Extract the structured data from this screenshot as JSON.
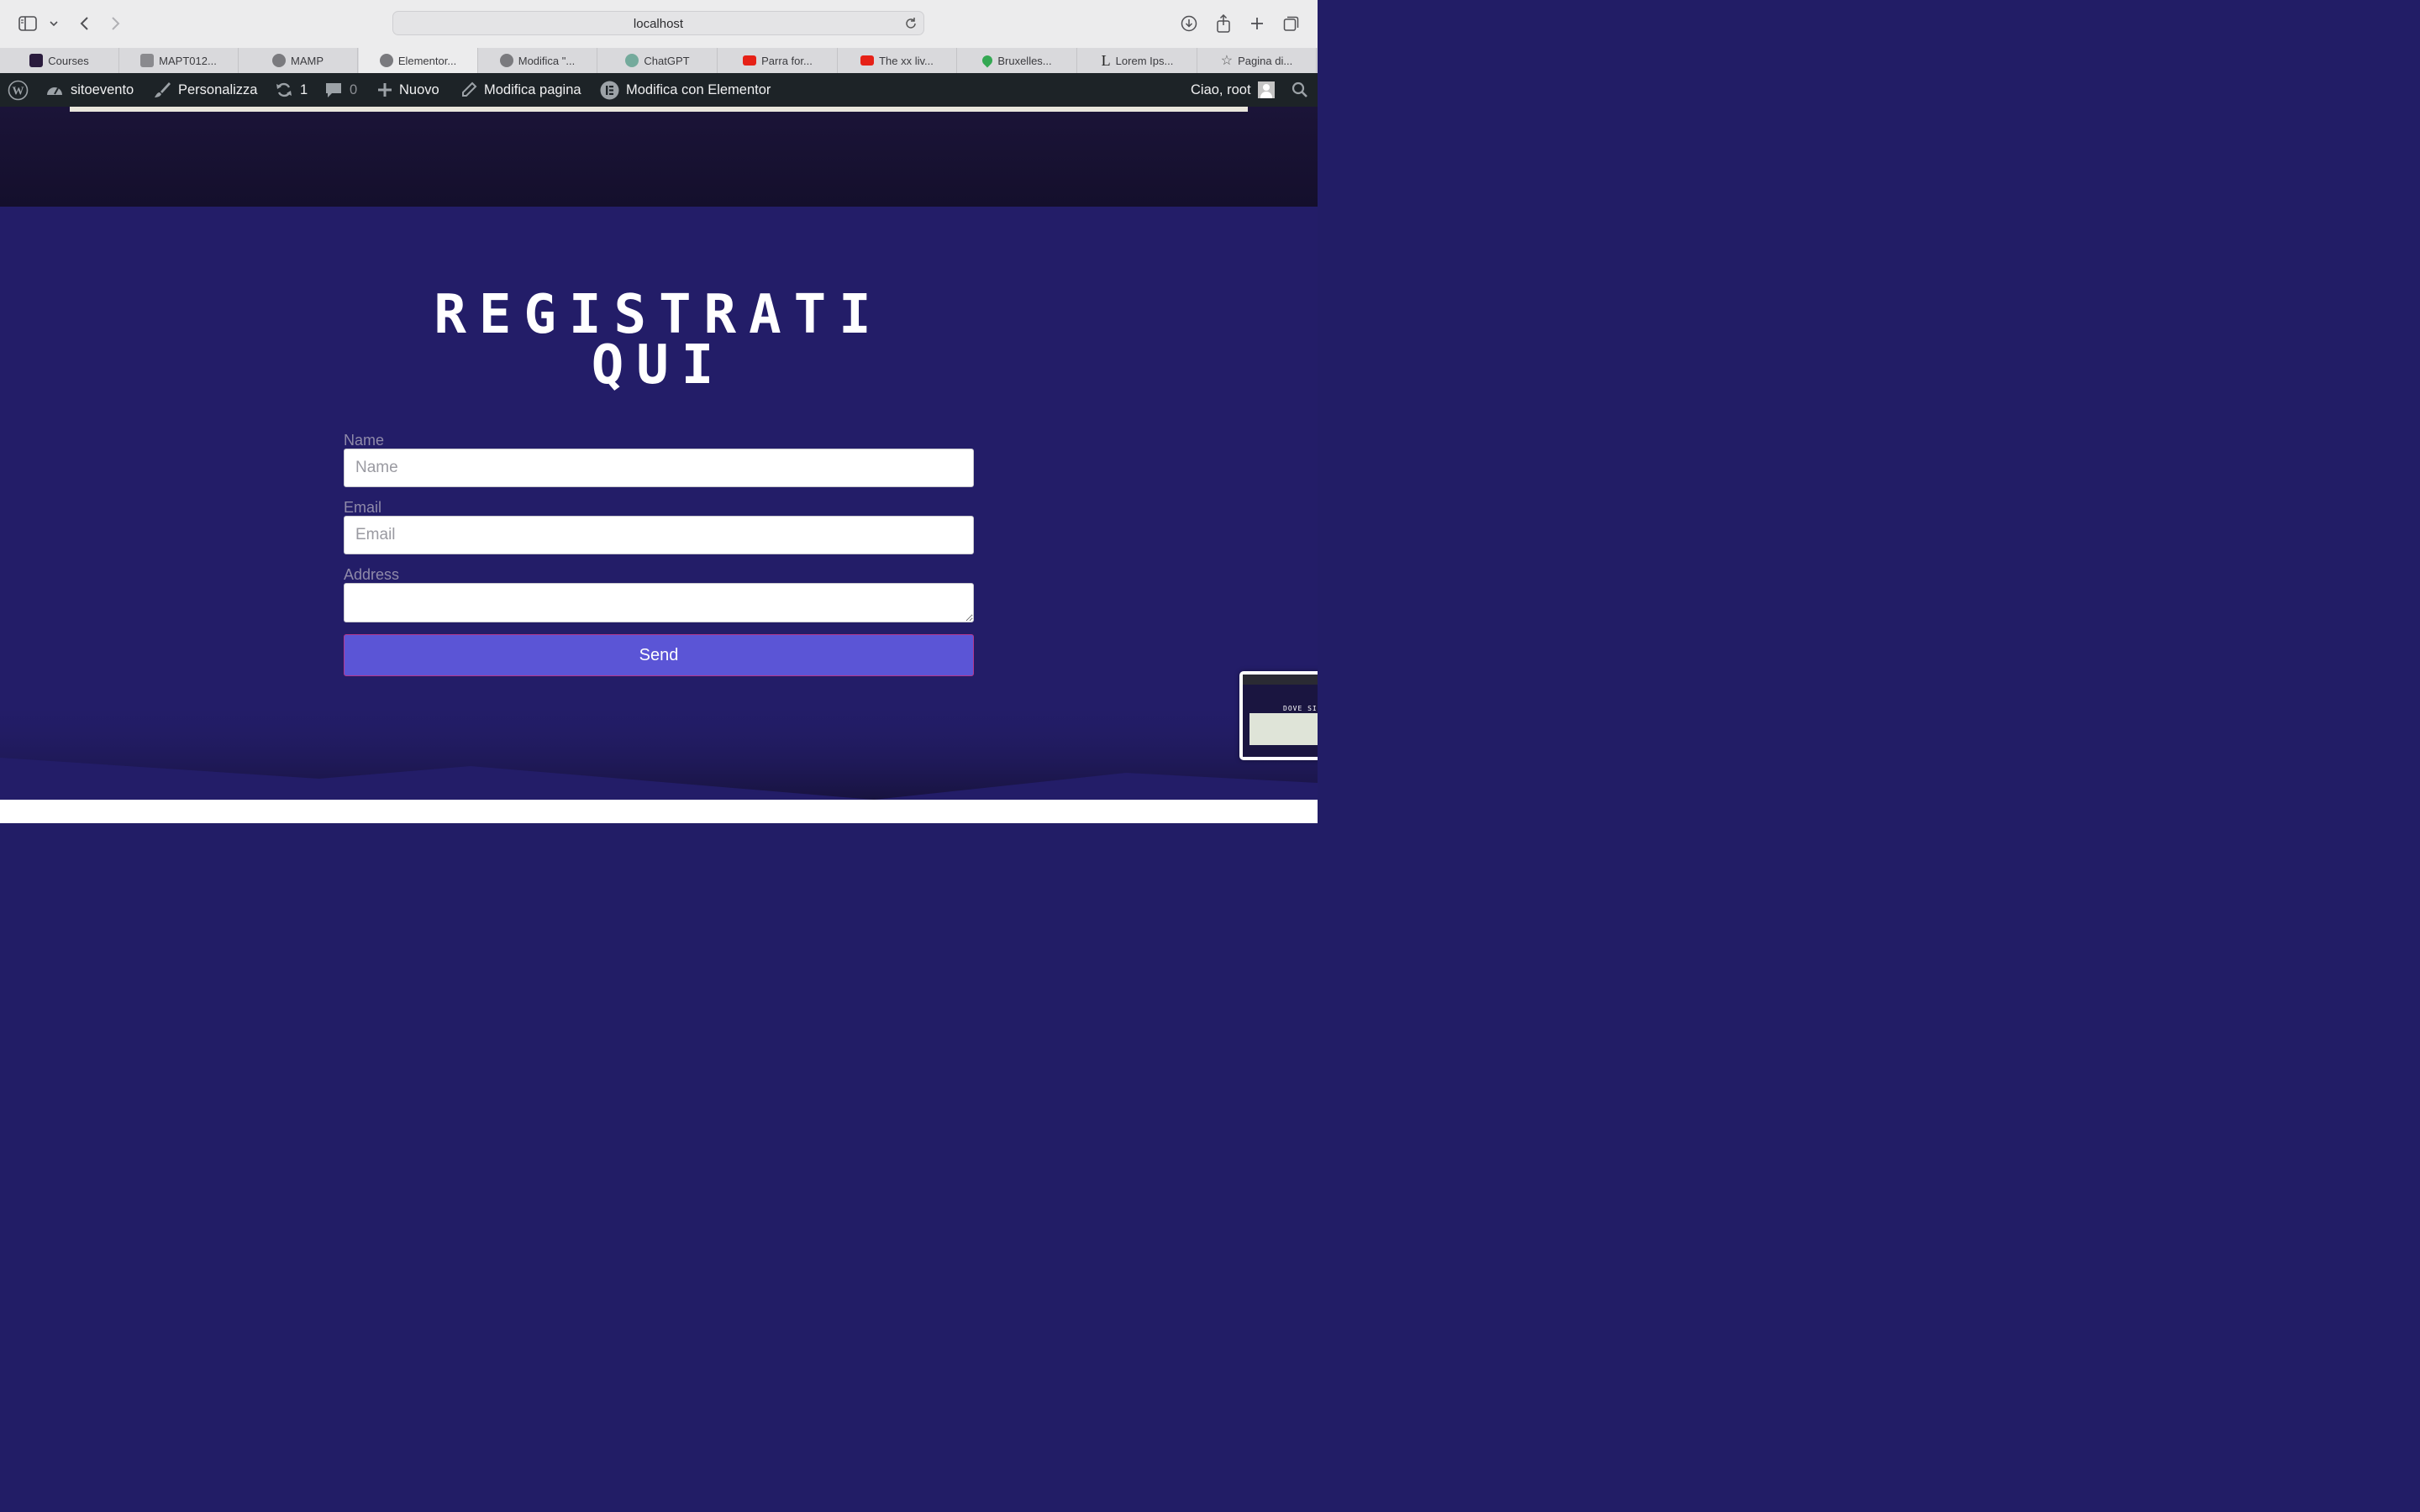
{
  "browser": {
    "url": "localhost",
    "tabs": [
      {
        "label": "Courses",
        "color": "#2a1b3d"
      },
      {
        "label": "MAPT012...",
        "color": "#8a8a8e"
      },
      {
        "label": "MAMP",
        "color": "#7a7a7e"
      },
      {
        "label": "Elementor...",
        "color": "#7a7a7e",
        "active": true
      },
      {
        "label": "Modifica \"...",
        "color": "#7a7a7e"
      },
      {
        "label": "ChatGPT",
        "color": "#74aa9c"
      },
      {
        "label": "Parra for...",
        "color": "#e62117"
      },
      {
        "label": "The xx liv...",
        "color": "#e62117"
      },
      {
        "label": "Bruxelles...",
        "color": "#34a853"
      },
      {
        "label": "Lorem Ips...",
        "color": "#222222"
      },
      {
        "label": "Pagina di...",
        "color": "#666666"
      }
    ]
  },
  "adminbar": {
    "site_name": "sitoevento",
    "customize": "Personalizza",
    "updates_count": "1",
    "comments_count": "0",
    "new": "Nuovo",
    "edit_page": "Modifica pagina",
    "edit_elementor": "Modifica con Elementor",
    "greeting": "Ciao, root"
  },
  "form": {
    "title_line1": "REGISTRATI",
    "title_line2": "QUI",
    "name_label": "Name",
    "name_placeholder": "Name",
    "email_label": "Email",
    "email_placeholder": "Email",
    "address_label": "Address",
    "send_label": "Send"
  },
  "colors": {
    "section_bg": "#231d68",
    "button_bg": "#5b55d6",
    "adminbar_bg": "#1d2327"
  }
}
